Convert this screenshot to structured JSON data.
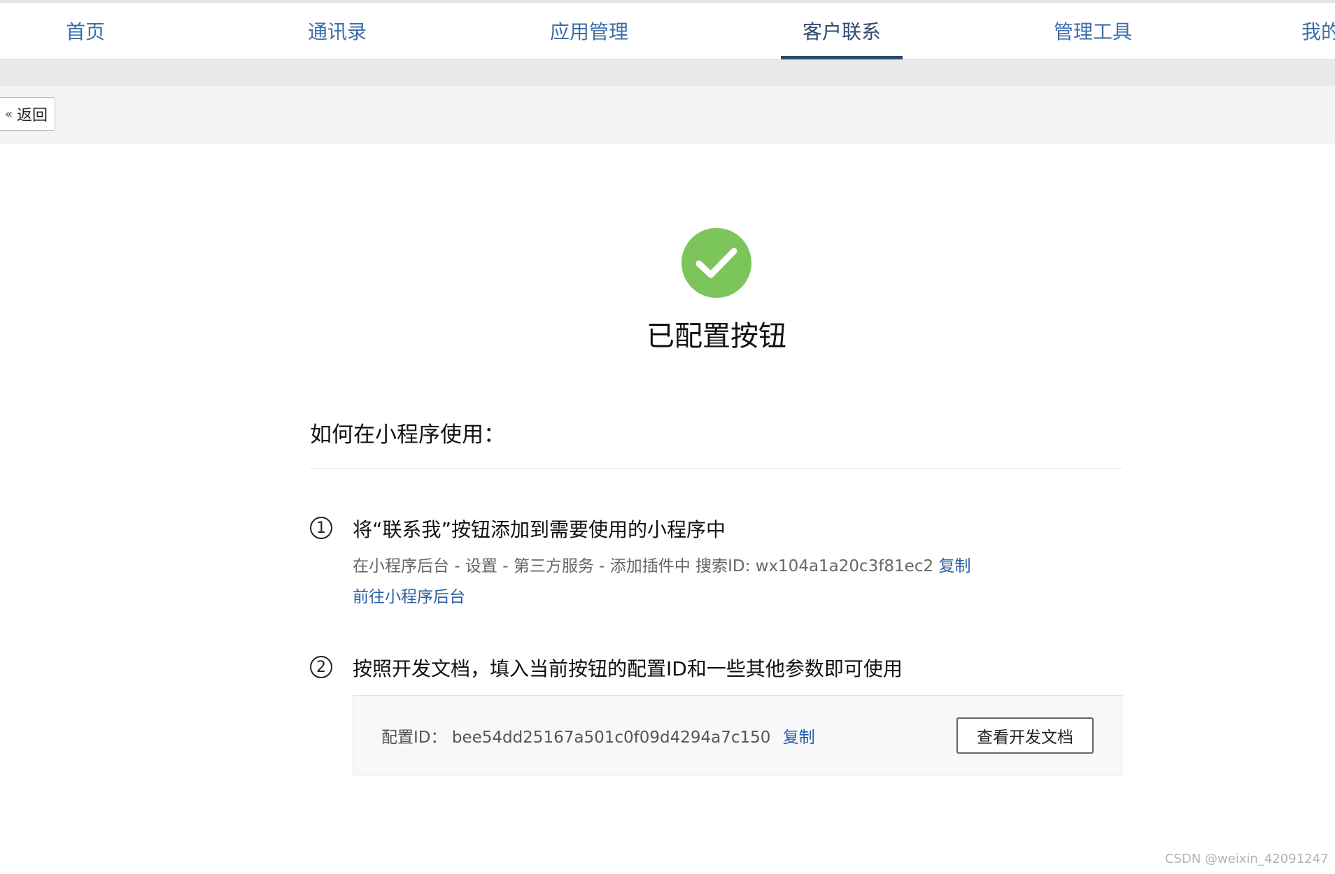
{
  "nav": {
    "items": [
      {
        "label": "首页"
      },
      {
        "label": "通讯录"
      },
      {
        "label": "应用管理"
      },
      {
        "label": "客户联系"
      },
      {
        "label": "管理工具"
      },
      {
        "label": "我的"
      }
    ],
    "active_index": 3
  },
  "toolbar": {
    "back_label": "返回"
  },
  "success": {
    "title": "已配置按钮"
  },
  "section": {
    "title": "如何在小程序使用："
  },
  "steps": [
    {
      "number": "1",
      "title": "将“联系我”按钮添加到需要使用的小程序中",
      "desc": "在小程序后台 - 设置 - 第三方服务 - 添加插件中 搜索ID: wx104a1a20c3f81ec2",
      "copy_label": "复制",
      "link_label": "前往小程序后台"
    },
    {
      "number": "2",
      "title": "按照开发文档，填入当前按钮的配置ID和一些其他参数即可使用"
    }
  ],
  "config": {
    "label": "配置ID：",
    "value": "bee54dd25167a501c0f09d4294a7c150",
    "copy_label": "复制",
    "doc_button_label": "查看开发文档"
  },
  "watermark": "CSDN @weixin_42091247",
  "colors": {
    "accent": "#2e4a6e",
    "link": "#2a5fa6",
    "success": "#7cc55a"
  }
}
